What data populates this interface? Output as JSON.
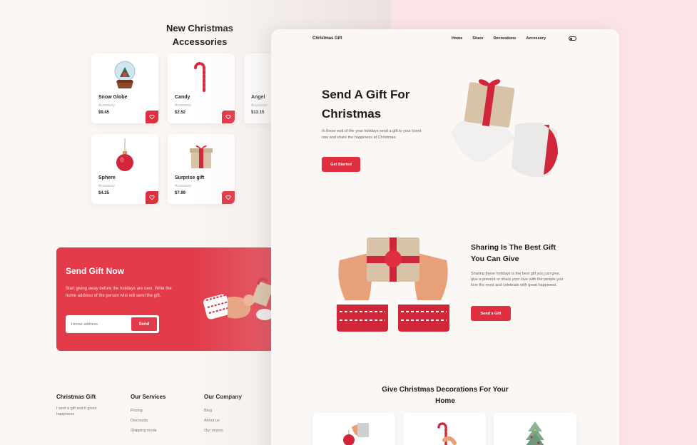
{
  "background_page": {
    "accessories_title": "New Christmas Accessories",
    "products": [
      {
        "name": "Snow Globe",
        "category": "Accessory",
        "price": "$9.45",
        "icon": "snow-globe"
      },
      {
        "name": "Candy",
        "category": "Accessory",
        "price": "$2.52",
        "icon": "candy-cane"
      },
      {
        "name": "Angel",
        "category": "Accessory",
        "price": "$13.15",
        "icon": "angel"
      },
      {
        "name": "Sphere",
        "category": "Accessory",
        "price": "$4.25",
        "icon": "ornament-ball"
      },
      {
        "name": "Surprise gift",
        "category": "Accessory",
        "price": "$7.99",
        "icon": "gift-box"
      }
    ],
    "send_gift": {
      "title": "Send Gift Now",
      "description": "Start giving away before the holidays are over. Write the home address of the person who will send the gift.",
      "input_placeholder": "House address",
      "button": "Send"
    },
    "footer": {
      "brand": {
        "title": "Christmas Gift",
        "description": "I sent a gift and it gives happiness"
      },
      "services": {
        "title": "Our Services",
        "links": [
          "Pricing",
          "Discounts",
          "Shipping mode"
        ]
      },
      "company": {
        "title": "Our Company",
        "links": [
          "Blog",
          "About us",
          "Our mision"
        ]
      }
    }
  },
  "foreground_page": {
    "logo": "Christmas Gift",
    "nav": [
      "Home",
      "Share",
      "Decorations",
      "Accessory"
    ],
    "active_nav": "Home",
    "hero": {
      "title": "Send A Gift For Christmas",
      "description": "In these end of the year holidays send a gift to your loved one and share the happiness at Christmas.",
      "button": "Get Started"
    },
    "share": {
      "title": "Sharing Is The Best Gift You Can Give",
      "description": "Sharing these holidays is the best gift you can give, give a present or share your love with the people you love the most and celebrate with great happiness.",
      "button": "Send a Gift"
    },
    "decorations": {
      "title": "Give Christmas Decorations For Your Home"
    }
  },
  "colors": {
    "accent": "#e0303f",
    "background": "#faf7f4",
    "page_bg": "#fbe4e6"
  }
}
